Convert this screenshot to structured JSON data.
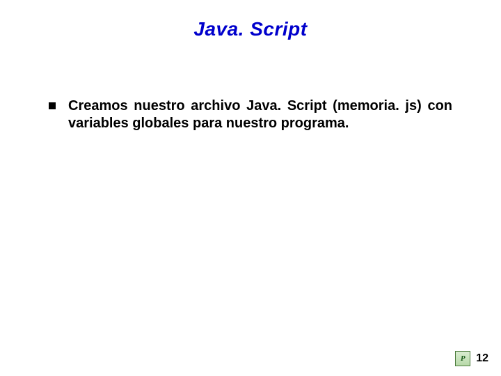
{
  "title": "Java. Script",
  "bullets": [
    {
      "text": "Creamos nuestro archivo Java. Script (memoria. js) con variables globales para nuestro programa."
    }
  ],
  "footer": {
    "logo_letter": "P",
    "page_number": "12"
  }
}
